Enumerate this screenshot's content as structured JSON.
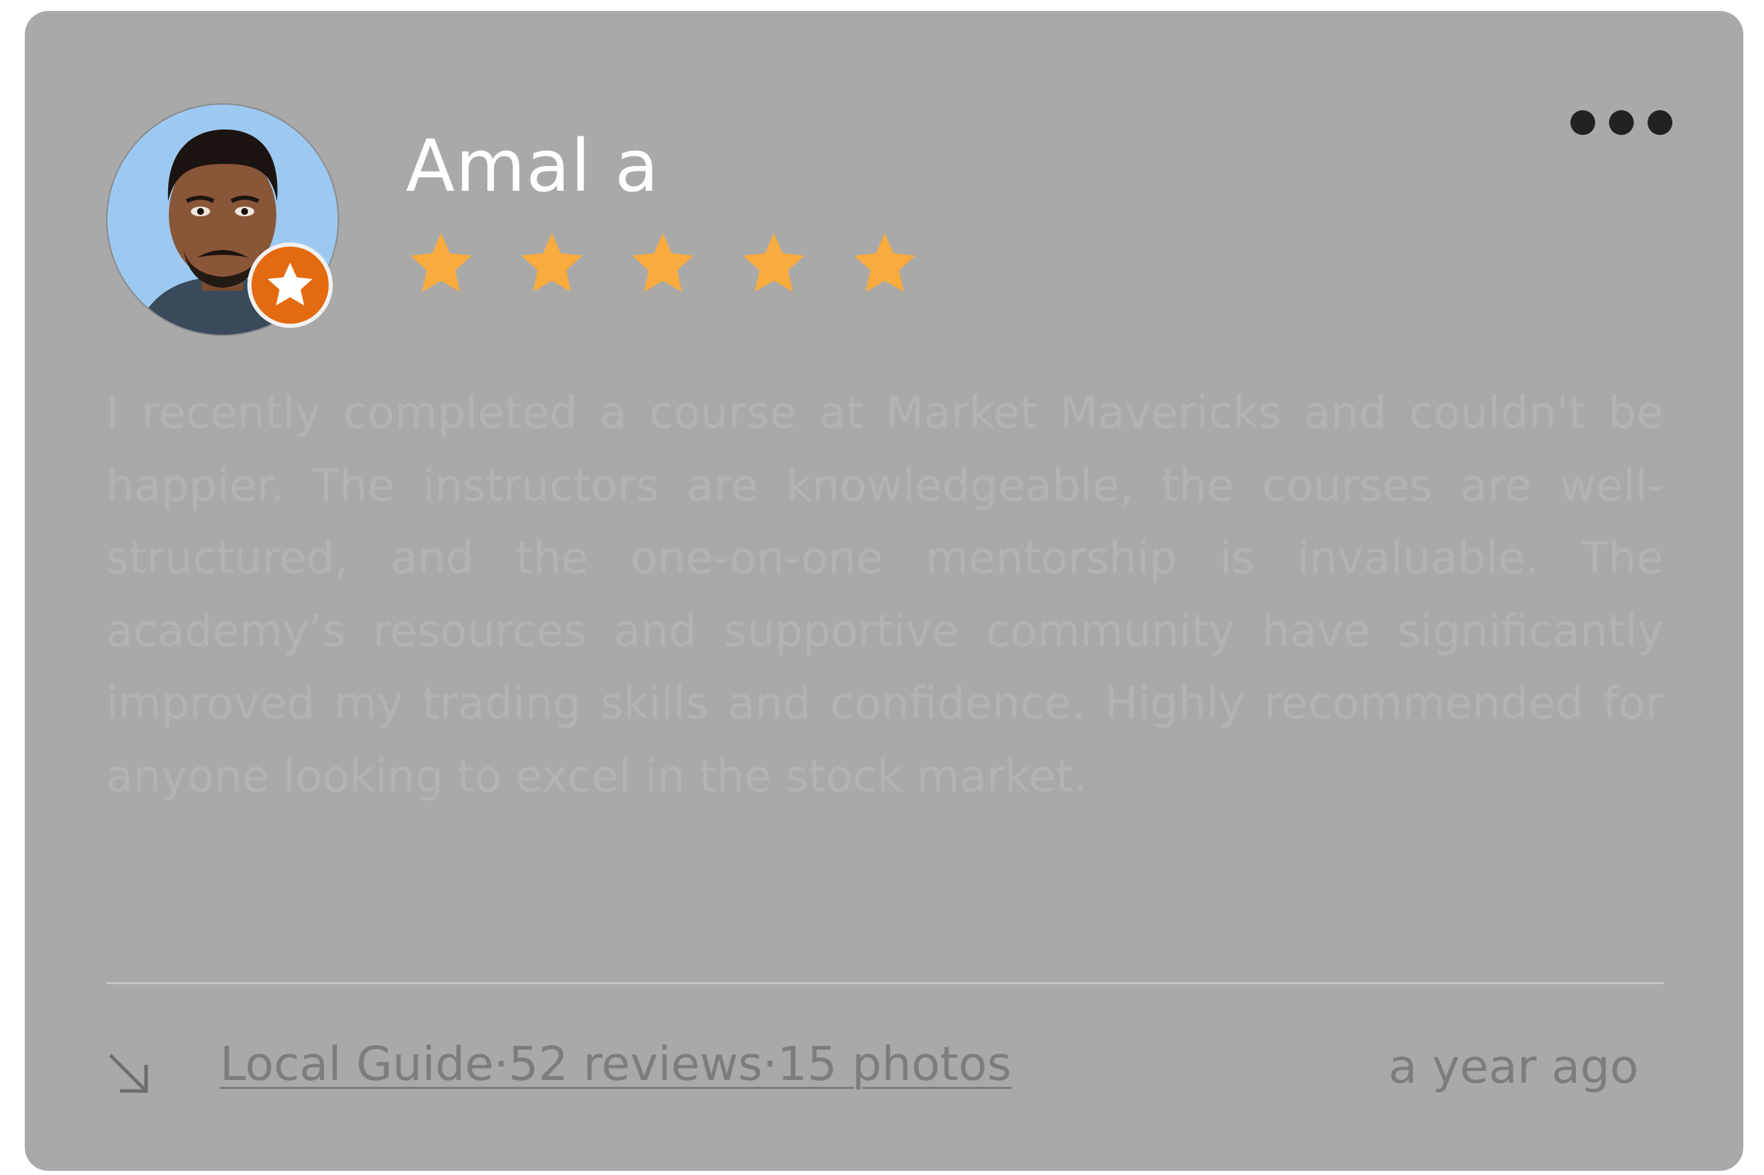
{
  "review": {
    "author_name": "Amal a",
    "rating": 5,
    "rating_max": 5,
    "text": "I recently completed a course at Market Mavericks and couldn't be happier. The instructors are knowledgeable, the courses are well-structured, and the one-on-one mentorship is invaluable. The academy’s resources and supportive community have significantly improved my trading skills and confidence. Highly recommended for anyone looking to excel in the stock market.",
    "author_meta": "Local Guide·52 reviews·15 photos",
    "time_ago": "a year ago"
  },
  "icons": {
    "avatar": "profile-photo",
    "badge": "local-guide-star-icon",
    "star": "star-icon",
    "more": "more-dots-icon",
    "link": "arrow-down-right-icon"
  },
  "colors": {
    "card_bg": "#a9a9a9",
    "star": "#f9ab3e",
    "badge": "#e46a10",
    "name": "#ffffff",
    "muted": "#7d7d7d"
  }
}
